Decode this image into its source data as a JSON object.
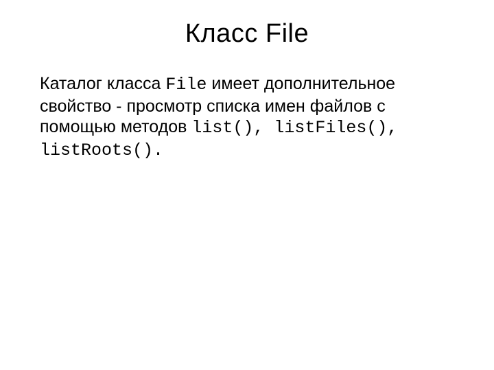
{
  "title": "Класс File",
  "body": {
    "t1": "Каталог класса ",
    "c1": "File",
    "t2": " имеет дополнительное свойство - просмотр списка имен файлов с помощью методов ",
    "c2": "list()",
    "sep1": ", ",
    "c3": "listFiles()",
    "sep2": ", ",
    "c4": "listRoots()",
    "period": "."
  }
}
